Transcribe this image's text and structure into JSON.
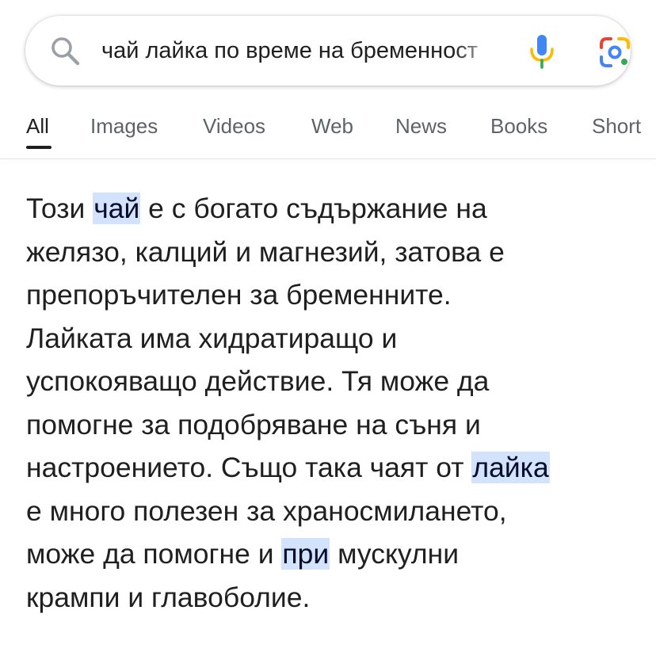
{
  "search": {
    "query": "чай лайка по време на бременност"
  },
  "tabs": [
    {
      "label": "All",
      "active": true
    },
    {
      "label": "Images"
    },
    {
      "label": "Videos"
    },
    {
      "label": "Web"
    },
    {
      "label": "News"
    },
    {
      "label": "Books"
    },
    {
      "label": "Short"
    }
  ],
  "snippet": {
    "line1_a": "Този ",
    "line1_hl": "чай",
    "line1_b": " е с богато съдържание на",
    "line2": "желязо, калций и магнезий, затова е",
    "line3": "препоръчителен за бременните.",
    "line4": "Лайката има хидратиращо и",
    "line5": "успокояващо действие. Тя може да",
    "line6": "помогне за подобряване на съня и",
    "line7_a": "настроението. Също така чаят от ",
    "line7_hl": "лайка",
    "line8": "е много полезен за храносмилането,",
    "line9_a": "може да помогне и ",
    "line9_hl": "при",
    "line9_b": " мускулни",
    "line10": "крампи и главоболие."
  },
  "colors": {
    "highlight": "#d3e3fd",
    "mic_blue": "#4285f4",
    "mic_yellow": "#fbbc04",
    "lens_red": "#ea4335",
    "lens_green": "#34a853"
  }
}
